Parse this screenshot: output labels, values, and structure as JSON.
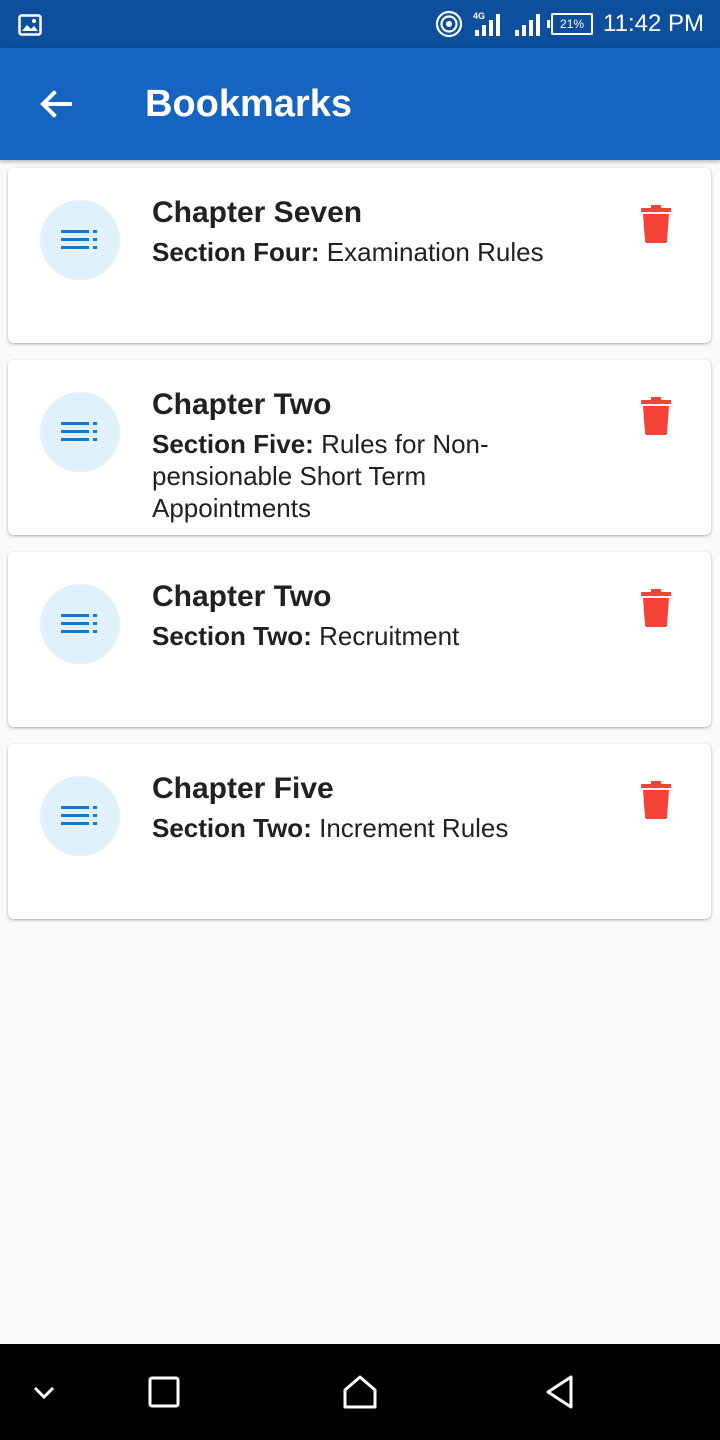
{
  "status_bar": {
    "time": "11:42 PM",
    "battery": "21%",
    "network": "4G",
    "icons": [
      "gallery-icon",
      "hotspot-icon",
      "signal-icon",
      "signal-icon",
      "battery-icon"
    ]
  },
  "app_bar": {
    "title": "Bookmarks",
    "back_icon": "arrow-back-icon"
  },
  "bookmarks": [
    {
      "chapter": "Chapter Seven",
      "section_label": "Section Four:",
      "section_title": "Examination Rules"
    },
    {
      "chapter": "Chapter Two",
      "section_label": "Section Five:",
      "section_title": "Rules for Non-pensionable Short Term Appointments"
    },
    {
      "chapter": "Chapter Two",
      "section_label": "Section Two:",
      "section_title": "Recruitment"
    },
    {
      "chapter": "Chapter Five",
      "section_label": "Section Two:",
      "section_title": "Increment Rules"
    }
  ],
  "colors": {
    "status_bar": "#0d4f9c",
    "app_bar": "#1565c0",
    "avatar_bg": "#e1f1fb",
    "avatar_icon": "#1976d2",
    "delete": "#f44336",
    "background": "#fafafa"
  },
  "nav_bar": {
    "icons": [
      "chevron-down-icon",
      "recents-square-icon",
      "home-icon",
      "back-triangle-icon"
    ]
  }
}
